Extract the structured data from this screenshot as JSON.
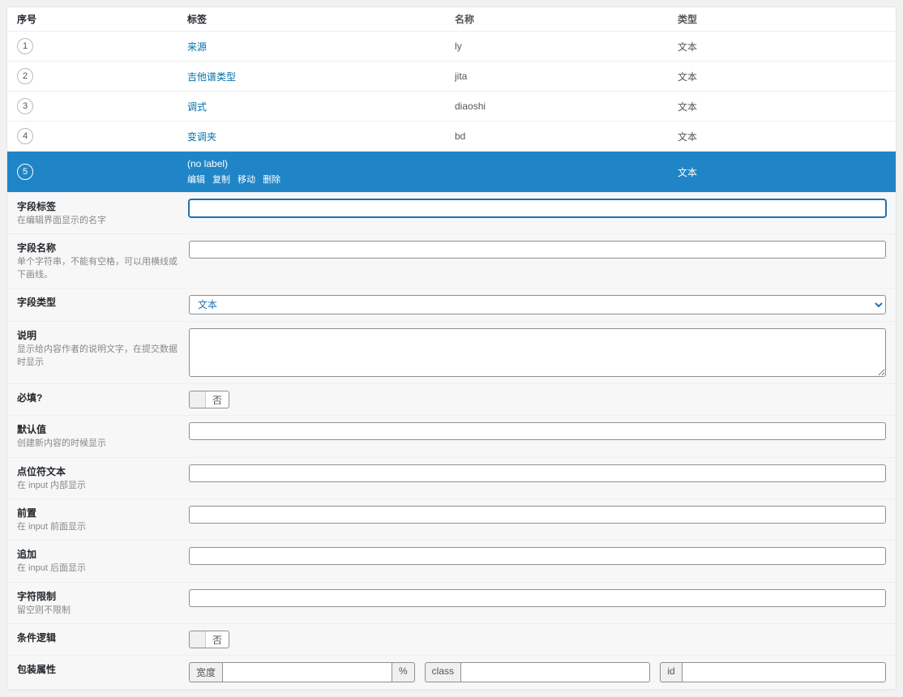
{
  "table": {
    "headers": {
      "order": "序号",
      "label": "标签",
      "name": "名称",
      "type": "类型"
    },
    "rows": [
      {
        "order": "1",
        "label": "来源",
        "name": "ly",
        "type": "文本"
      },
      {
        "order": "2",
        "label": "吉他谱类型",
        "name": "jita",
        "type": "文本"
      },
      {
        "order": "3",
        "label": "调式",
        "name": "diaoshi",
        "type": "文本"
      },
      {
        "order": "4",
        "label": "变调夹",
        "name": "bd",
        "type": "文本"
      }
    ],
    "active": {
      "order": "5",
      "label": "(no label)",
      "type": "文本",
      "actions": {
        "edit": "编辑",
        "copy": "复制",
        "move": "移动",
        "delete": "删除"
      }
    }
  },
  "form": {
    "fieldLabel": {
      "label": "字段标签",
      "desc": "在编辑界面显示的名字",
      "value": ""
    },
    "fieldName": {
      "label": "字段名称",
      "desc": "单个字符串，不能有空格，可以用横线或下画线。",
      "value": ""
    },
    "fieldType": {
      "label": "字段类型",
      "value": "文本"
    },
    "description": {
      "label": "说明",
      "desc": "显示给内容作者的说明文字，在提交数据时显示",
      "value": ""
    },
    "required": {
      "label": "必填?",
      "state": "否"
    },
    "default": {
      "label": "默认值",
      "desc": "创建新内容的时候显示",
      "value": ""
    },
    "placeholder": {
      "label": "点位符文本",
      "desc": "在 input 内部显示",
      "value": ""
    },
    "prepend": {
      "label": "前置",
      "desc": "在 input 前面显示",
      "value": ""
    },
    "append": {
      "label": "追加",
      "desc": "在 input 后面显示",
      "value": ""
    },
    "charLimit": {
      "label": "字符限制",
      "desc": "留空则不限制",
      "value": ""
    },
    "conditional": {
      "label": "条件逻辑",
      "state": "否"
    },
    "wrapper": {
      "label": "包装属性",
      "width": "宽度",
      "pct": "%",
      "class": "class",
      "id": "id",
      "widthVal": "",
      "classVal": "",
      "idVal": ""
    }
  }
}
